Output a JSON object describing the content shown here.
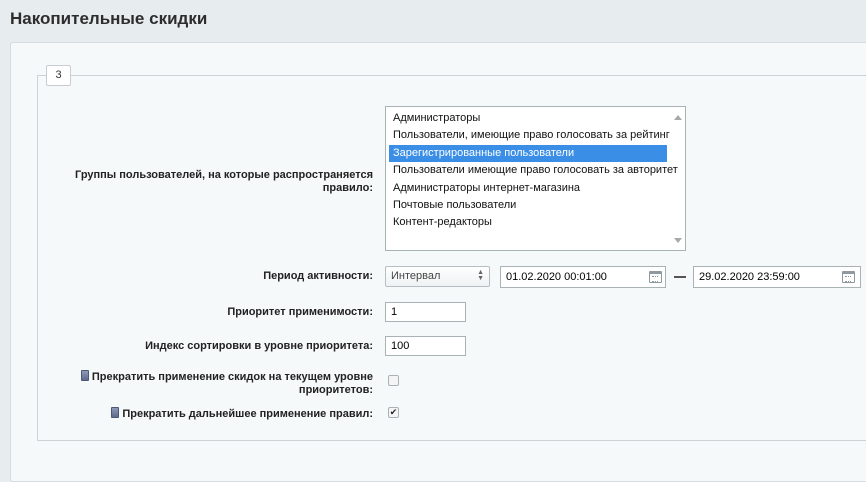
{
  "page": {
    "title": "Накопительные скидки"
  },
  "tab": {
    "label": "3"
  },
  "groups": {
    "label": "Группы пользователей, на которые распространяется правило:",
    "items": [
      {
        "label": "Администраторы",
        "selected": false
      },
      {
        "label": "Пользователи, имеющие право голосовать за рейтинг",
        "selected": false
      },
      {
        "label": "Зарегистрированные пользователи",
        "selected": true
      },
      {
        "label": "Пользователи имеющие право голосовать за авторитет",
        "selected": false
      },
      {
        "label": "Администраторы интернет-магазина",
        "selected": false
      },
      {
        "label": "Почтовые пользователи",
        "selected": false
      },
      {
        "label": "Контент-редакторы",
        "selected": false
      }
    ]
  },
  "period": {
    "label": "Период активности:",
    "type_value": "Интервал",
    "from_value": "01.02.2020 00:01:00",
    "to_value": "29.02.2020 23:59:00"
  },
  "priority": {
    "label": "Приоритет применимости:",
    "value": "1"
  },
  "sort_index": {
    "label": "Индекс сортировки в уровне приоритета:",
    "value": "100"
  },
  "stop_level": {
    "label": "Прекратить применение скидок на текущем уровне приоритетов:",
    "checked": false
  },
  "stop_rules": {
    "label": "Прекратить дальнейшее применение правил:",
    "checked": true,
    "check_glyph": "✔"
  },
  "colors": {
    "selection": "#3a8ee6",
    "background": "#e7ecee"
  }
}
